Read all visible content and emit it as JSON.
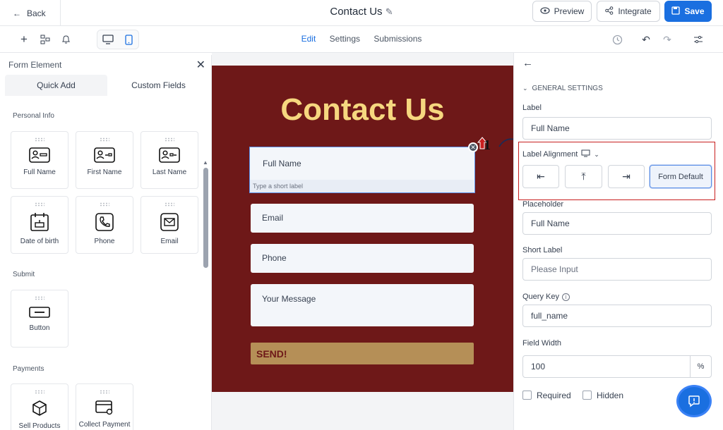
{
  "topbar": {
    "back_label": "Back",
    "title": "Contact Us",
    "preview_label": "Preview",
    "integrate_label": "Integrate",
    "save_label": "Save"
  },
  "toolbar": {
    "tabs": [
      "Edit",
      "Settings",
      "Submissions"
    ],
    "active_tab": "Edit"
  },
  "left_panel": {
    "title": "Form Element",
    "tabs": [
      "Quick Add",
      "Custom Fields"
    ],
    "sections": [
      {
        "name": "Personal Info",
        "items": [
          "Full Name",
          "First Name",
          "Last Name",
          "Date of birth",
          "Phone",
          "Email"
        ]
      },
      {
        "name": "Submit",
        "items": [
          "Button"
        ]
      },
      {
        "name": "Payments",
        "items": [
          "Sell Products",
          "Collect Payment"
        ]
      }
    ]
  },
  "form": {
    "title": "Contact Us",
    "full_name_label": "Full Name",
    "short_label_placeholder": "Type a short label",
    "email_placeholder": "Email",
    "phone_placeholder": "Phone",
    "message_placeholder": "Your Message",
    "send_label": "SEND!",
    "badge_number": "1"
  },
  "right_panel": {
    "section_title": "GENERAL SETTINGS",
    "label_title": "Label",
    "label_value": "Full Name",
    "label_alignment_title": "Label Alignment",
    "alignment_options": [
      "left",
      "top",
      "right",
      "Form Default"
    ],
    "alignment_selected": "Form Default",
    "placeholder_title": "Placeholder",
    "placeholder_value": "Full Name",
    "short_label_title": "Short Label",
    "short_label_placeholder": "Please Input",
    "query_key_title": "Query Key",
    "query_key_value": "full_name",
    "field_width_title": "Field Width",
    "field_width_value": "100",
    "field_width_unit": "%",
    "required_label": "Required",
    "hidden_label": "Hidden"
  },
  "colors": {
    "accent": "#1a6fe0",
    "form_bg": "#6e1818",
    "title_gold": "#f6d77f",
    "send_bg": "#b58f57",
    "highlight_red": "#c81e1e"
  }
}
